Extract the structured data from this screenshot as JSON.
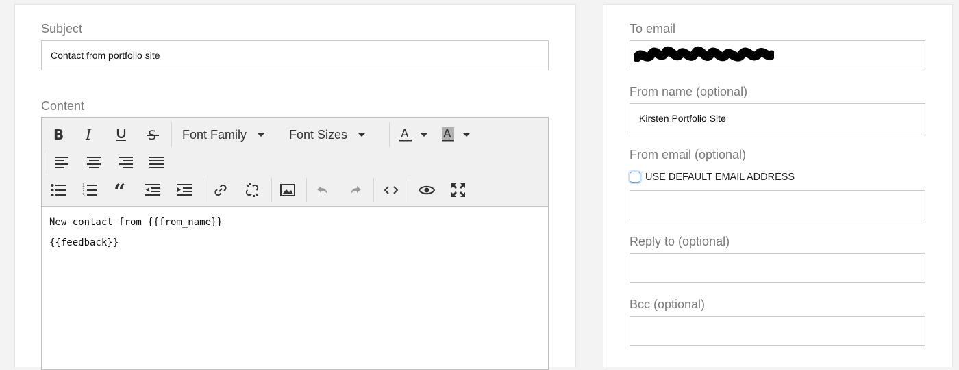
{
  "left": {
    "subject_label": "Subject",
    "subject_value": "Contact from portfolio site",
    "content_label": "Content",
    "toolbar": {
      "font_family": "Font Family",
      "font_sizes": "Font Sizes",
      "icons": [
        "bold-icon",
        "italic-icon",
        "underline-icon",
        "strikethrough-icon",
        "text-color-icon",
        "background-color-icon",
        "align-left-icon",
        "align-center-icon",
        "align-right-icon",
        "align-justify-icon",
        "bullet-list-icon",
        "numbered-list-icon",
        "blockquote-icon",
        "outdent-icon",
        "indent-icon",
        "link-icon",
        "unlink-icon",
        "image-icon",
        "undo-icon",
        "redo-icon",
        "code-icon",
        "preview-icon",
        "fullscreen-icon"
      ]
    },
    "editor_lines": [
      "New contact from {{from_name}}",
      "{{feedback}}"
    ]
  },
  "right": {
    "to_email_label": "To email",
    "to_email_value": "",
    "from_name_label": "From name (optional)",
    "from_name_value": "Kirsten Portfolio Site",
    "from_email_label": "From email (optional)",
    "default_email_checkbox": "USE DEFAULT EMAIL ADDRESS",
    "from_email_value": "",
    "reply_to_label": "Reply to (optional)",
    "reply_to_value": "",
    "bcc_label": "Bcc (optional)",
    "bcc_value": ""
  },
  "colors": {
    "background": "#f3f3f3",
    "panel": "#ffffff",
    "toolbar": "#f0f0f0",
    "label": "#7a7a7a",
    "checkbox_focus": "#6fa0e0"
  }
}
